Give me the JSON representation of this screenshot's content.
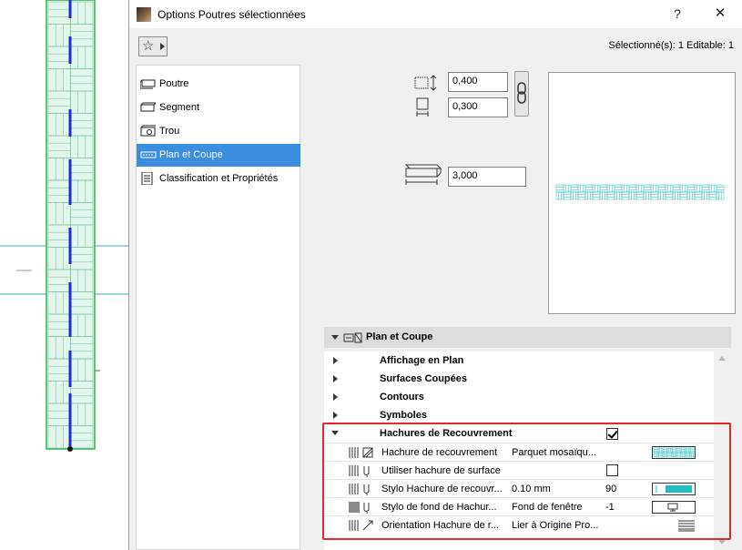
{
  "window": {
    "title": "Options Poutres sélectionnées",
    "help_glyph": "?",
    "close_glyph": "✕"
  },
  "toolbar": {
    "favorites_glyph": "☆",
    "selection_info": "Sélectionné(s): 1 Editable: 1"
  },
  "nav": {
    "items": [
      {
        "label": "Poutre",
        "icon": "beam-icon"
      },
      {
        "label": "Segment",
        "icon": "segment-icon"
      },
      {
        "label": "Trou",
        "icon": "hole-icon"
      },
      {
        "label": "Plan et Coupe",
        "icon": "floor-plan-section-icon",
        "active": true
      },
      {
        "label": "Classification et Propriétés",
        "icon": "classification-icon"
      }
    ]
  },
  "geometry_fields": {
    "width": "0,400",
    "height": "0,300",
    "length": "3,000"
  },
  "section": {
    "title": "Plan et Coupe",
    "groups": [
      {
        "label": "Affichage en Plan"
      },
      {
        "label": "Surfaces Coupées"
      },
      {
        "label": "Contours"
      },
      {
        "label": "Symboles"
      }
    ],
    "expanded_group": {
      "label": "Hachures de Recouvrement",
      "checked": true
    },
    "properties": [
      {
        "label": "Hachure de recouvrement",
        "value": "Parquet mosaïqu...",
        "num": "",
        "icon": "fill-pattern-icon"
      },
      {
        "label": "Utiliser hachure de surface",
        "value": "",
        "num": "",
        "icon": "surface-fill-icon",
        "checkbox": false
      },
      {
        "label": "Stylo Hachure de recouvr...",
        "value": "0.10 mm",
        "num": "90",
        "icon": "pen-icon"
      },
      {
        "label": "Stylo de fond de Hachur...",
        "value": "Fond de fenêtre",
        "num": "-1",
        "icon": "background-pen-icon"
      },
      {
        "label": "Orientation Hachure de r...",
        "value": "Lier à Origine Pro...",
        "num": "",
        "icon": "orientation-icon"
      }
    ]
  },
  "colors": {
    "accent": "#3b8de0",
    "pattern": "#1fbfbf",
    "highlight": "#e8262b",
    "beam_outline": "#2db34a",
    "beam_fill": "#dff5ec",
    "beam_axis": "#1e2bd6"
  }
}
